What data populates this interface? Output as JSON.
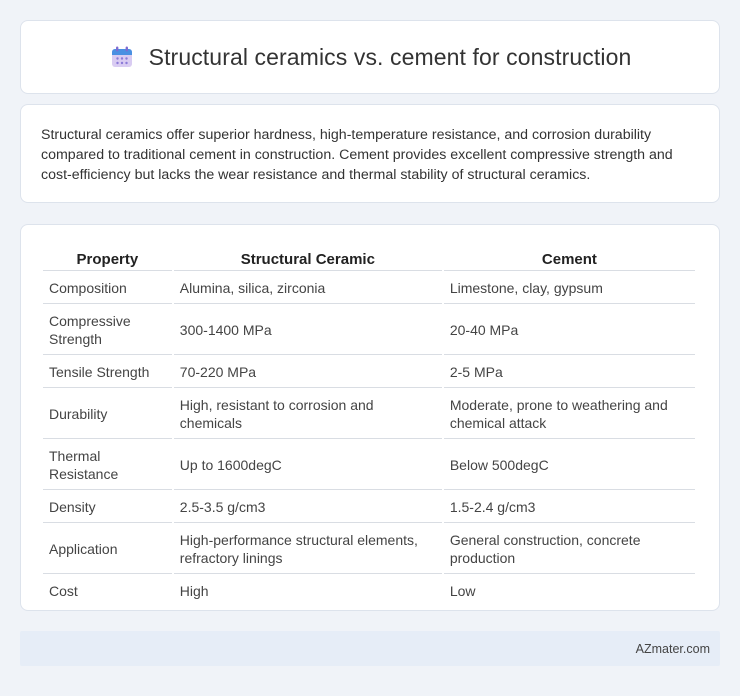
{
  "header": {
    "title": "Structural ceramics vs. cement for construction",
    "icon": "calendar-icon"
  },
  "summary": {
    "text": "Structural ceramics offer superior hardness, high-temperature resistance, and corrosion durability compared to traditional cement in construction. Cement provides excellent compressive strength and cost-efficiency but lacks the wear resistance and thermal stability of structural ceramics."
  },
  "table": {
    "headers": [
      "Property",
      "Structural Ceramic",
      "Cement"
    ],
    "rows": [
      [
        "Composition",
        "Alumina, silica, zirconia",
        "Limestone, clay, gypsum"
      ],
      [
        "Compressive Strength",
        "300-1400 MPa",
        "20-40 MPa"
      ],
      [
        "Tensile Strength",
        "70-220 MPa",
        "2-5 MPa"
      ],
      [
        "Durability",
        "High, resistant to corrosion and chemicals",
        "Moderate, prone to weathering and chemical attack"
      ],
      [
        "Thermal Resistance",
        "Up to 1600degC",
        "Below 500degC"
      ],
      [
        "Density",
        "2.5-3.5 g/cm3",
        "1.5-2.4 g/cm3"
      ],
      [
        "Application",
        "High-performance structural elements, refractory linings",
        "General construction, concrete production"
      ],
      [
        "Cost",
        "High",
        "Low"
      ]
    ]
  },
  "footer": {
    "brand": "AZmater.com"
  },
  "colors": {
    "background": "#f0f3f8",
    "card": "#ffffff",
    "footer_bar": "#e6edf7"
  }
}
